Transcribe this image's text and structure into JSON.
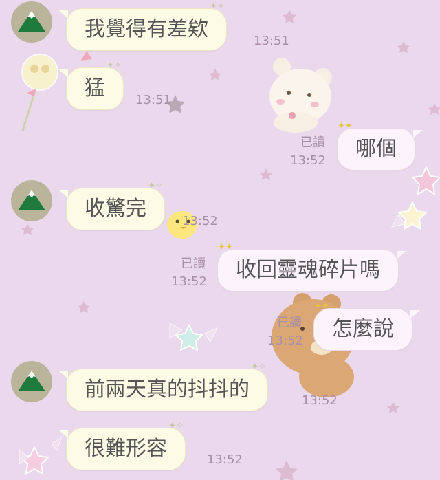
{
  "messages": [
    {
      "text": "我覺得有差欸",
      "time": "13:51"
    },
    {
      "text": "猛",
      "time": "13:51"
    },
    {
      "text": "哪個",
      "time": "13:52",
      "read": "已讀"
    },
    {
      "text": "收驚完",
      "time": "13:52"
    },
    {
      "text": "收回靈魂碎片嗎",
      "time": "13:52",
      "read": "已讀"
    },
    {
      "text": "怎麼說",
      "time": "13:52",
      "read": "已讀"
    },
    {
      "text": "前兩天真的抖抖的",
      "time": "13:52"
    },
    {
      "text": "很難形容",
      "time": "13:52"
    }
  ],
  "colors": {
    "background": "#ead8ec",
    "incoming_bubble": "#fbfbe6",
    "outgoing_bubble": "#fcf3fb",
    "meta_text": "#a88fa8",
    "avatar_bg": "#b9b49a",
    "avatar_mountain": "#1f7a3e"
  },
  "icons": {
    "avatar": "mountain-avatar-icon",
    "decoration": "star-icon"
  }
}
